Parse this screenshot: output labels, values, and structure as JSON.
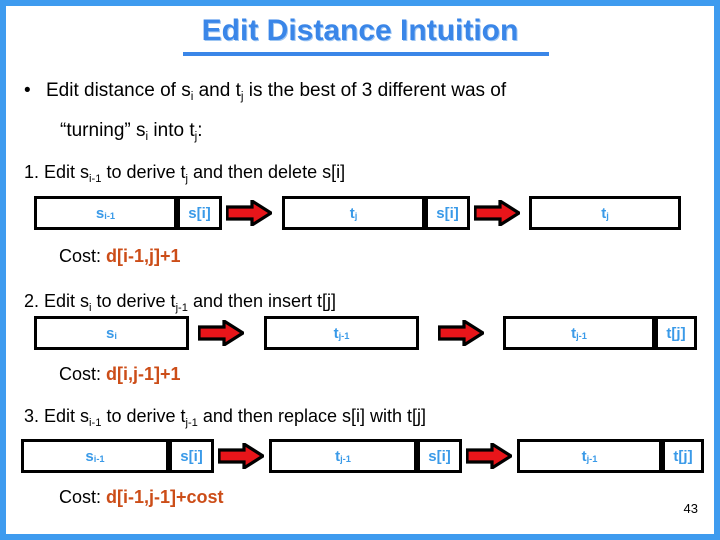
{
  "slide": {
    "title": "Edit Distance Intuition",
    "page_number": "43",
    "frame_color": "#3e9bef",
    "title_color": "#3a86e8",
    "box_text_color": "#3a9ae8",
    "cost_color": "#cc4d18",
    "arrow_fill": "#e8151a",
    "arrow_outline": "#000000"
  },
  "bullet": {
    "marker": "•",
    "line1_a": "Edit distance of s",
    "line1_sub1": "i",
    "line1_b": " and t",
    "line1_sub2": "j",
    "line1_c": " is the best of 3 different was of",
    "line2_a": "“turning” s",
    "line2_sub1": "i",
    "line2_b": " into t",
    "line2_sub2": "j",
    "line2_c": ":"
  },
  "steps": [
    {
      "heading_a": "1. Edit s",
      "heading_sub1": "i-1",
      "heading_b": " to derive t",
      "heading_sub2": "j",
      "heading_c": " and then delete s[i]",
      "cost_label": "Cost:",
      "cost_formula": "d[i-1,j]+1",
      "boxes": [
        {
          "main": "s",
          "sub": "i-1",
          "full": ""
        },
        {
          "main": "",
          "sub": "",
          "full": "s[i]"
        },
        {
          "main": "t",
          "sub": "j",
          "full": ""
        },
        {
          "main": "",
          "sub": "",
          "full": "s[i]"
        },
        {
          "main": "t",
          "sub": "j",
          "full": ""
        }
      ]
    },
    {
      "heading_a": "2. Edit s",
      "heading_sub1": "i",
      "heading_b": " to derive t",
      "heading_sub2": "j-1",
      "heading_c": " and then insert t[j]",
      "cost_label": "Cost:",
      "cost_formula": "d[i,j-1]+1",
      "boxes": [
        {
          "main": "s",
          "sub": "i",
          "full": ""
        },
        {
          "main": "t",
          "sub": "j-1",
          "full": ""
        },
        {
          "main": "t",
          "sub": "j-1",
          "full": ""
        },
        {
          "main": "",
          "sub": "",
          "full": "t[j]"
        }
      ]
    },
    {
      "heading_a": "3. Edit s",
      "heading_sub1": "i-1",
      "heading_b": " to derive t",
      "heading_sub2": "j-1",
      "heading_c": " and then replace s[i] with t[j]",
      "cost_label": "Cost:",
      "cost_formula": "d[i-1,j-1]+cost",
      "boxes": [
        {
          "main": "s",
          "sub": "i-1",
          "full": ""
        },
        {
          "main": "",
          "sub": "",
          "full": "s[i]"
        },
        {
          "main": "t",
          "sub": "j-1",
          "full": ""
        },
        {
          "main": "",
          "sub": "",
          "full": "s[i]"
        },
        {
          "main": "t",
          "sub": "j-1",
          "full": ""
        },
        {
          "main": "",
          "sub": "",
          "full": "t[j]"
        }
      ]
    }
  ]
}
